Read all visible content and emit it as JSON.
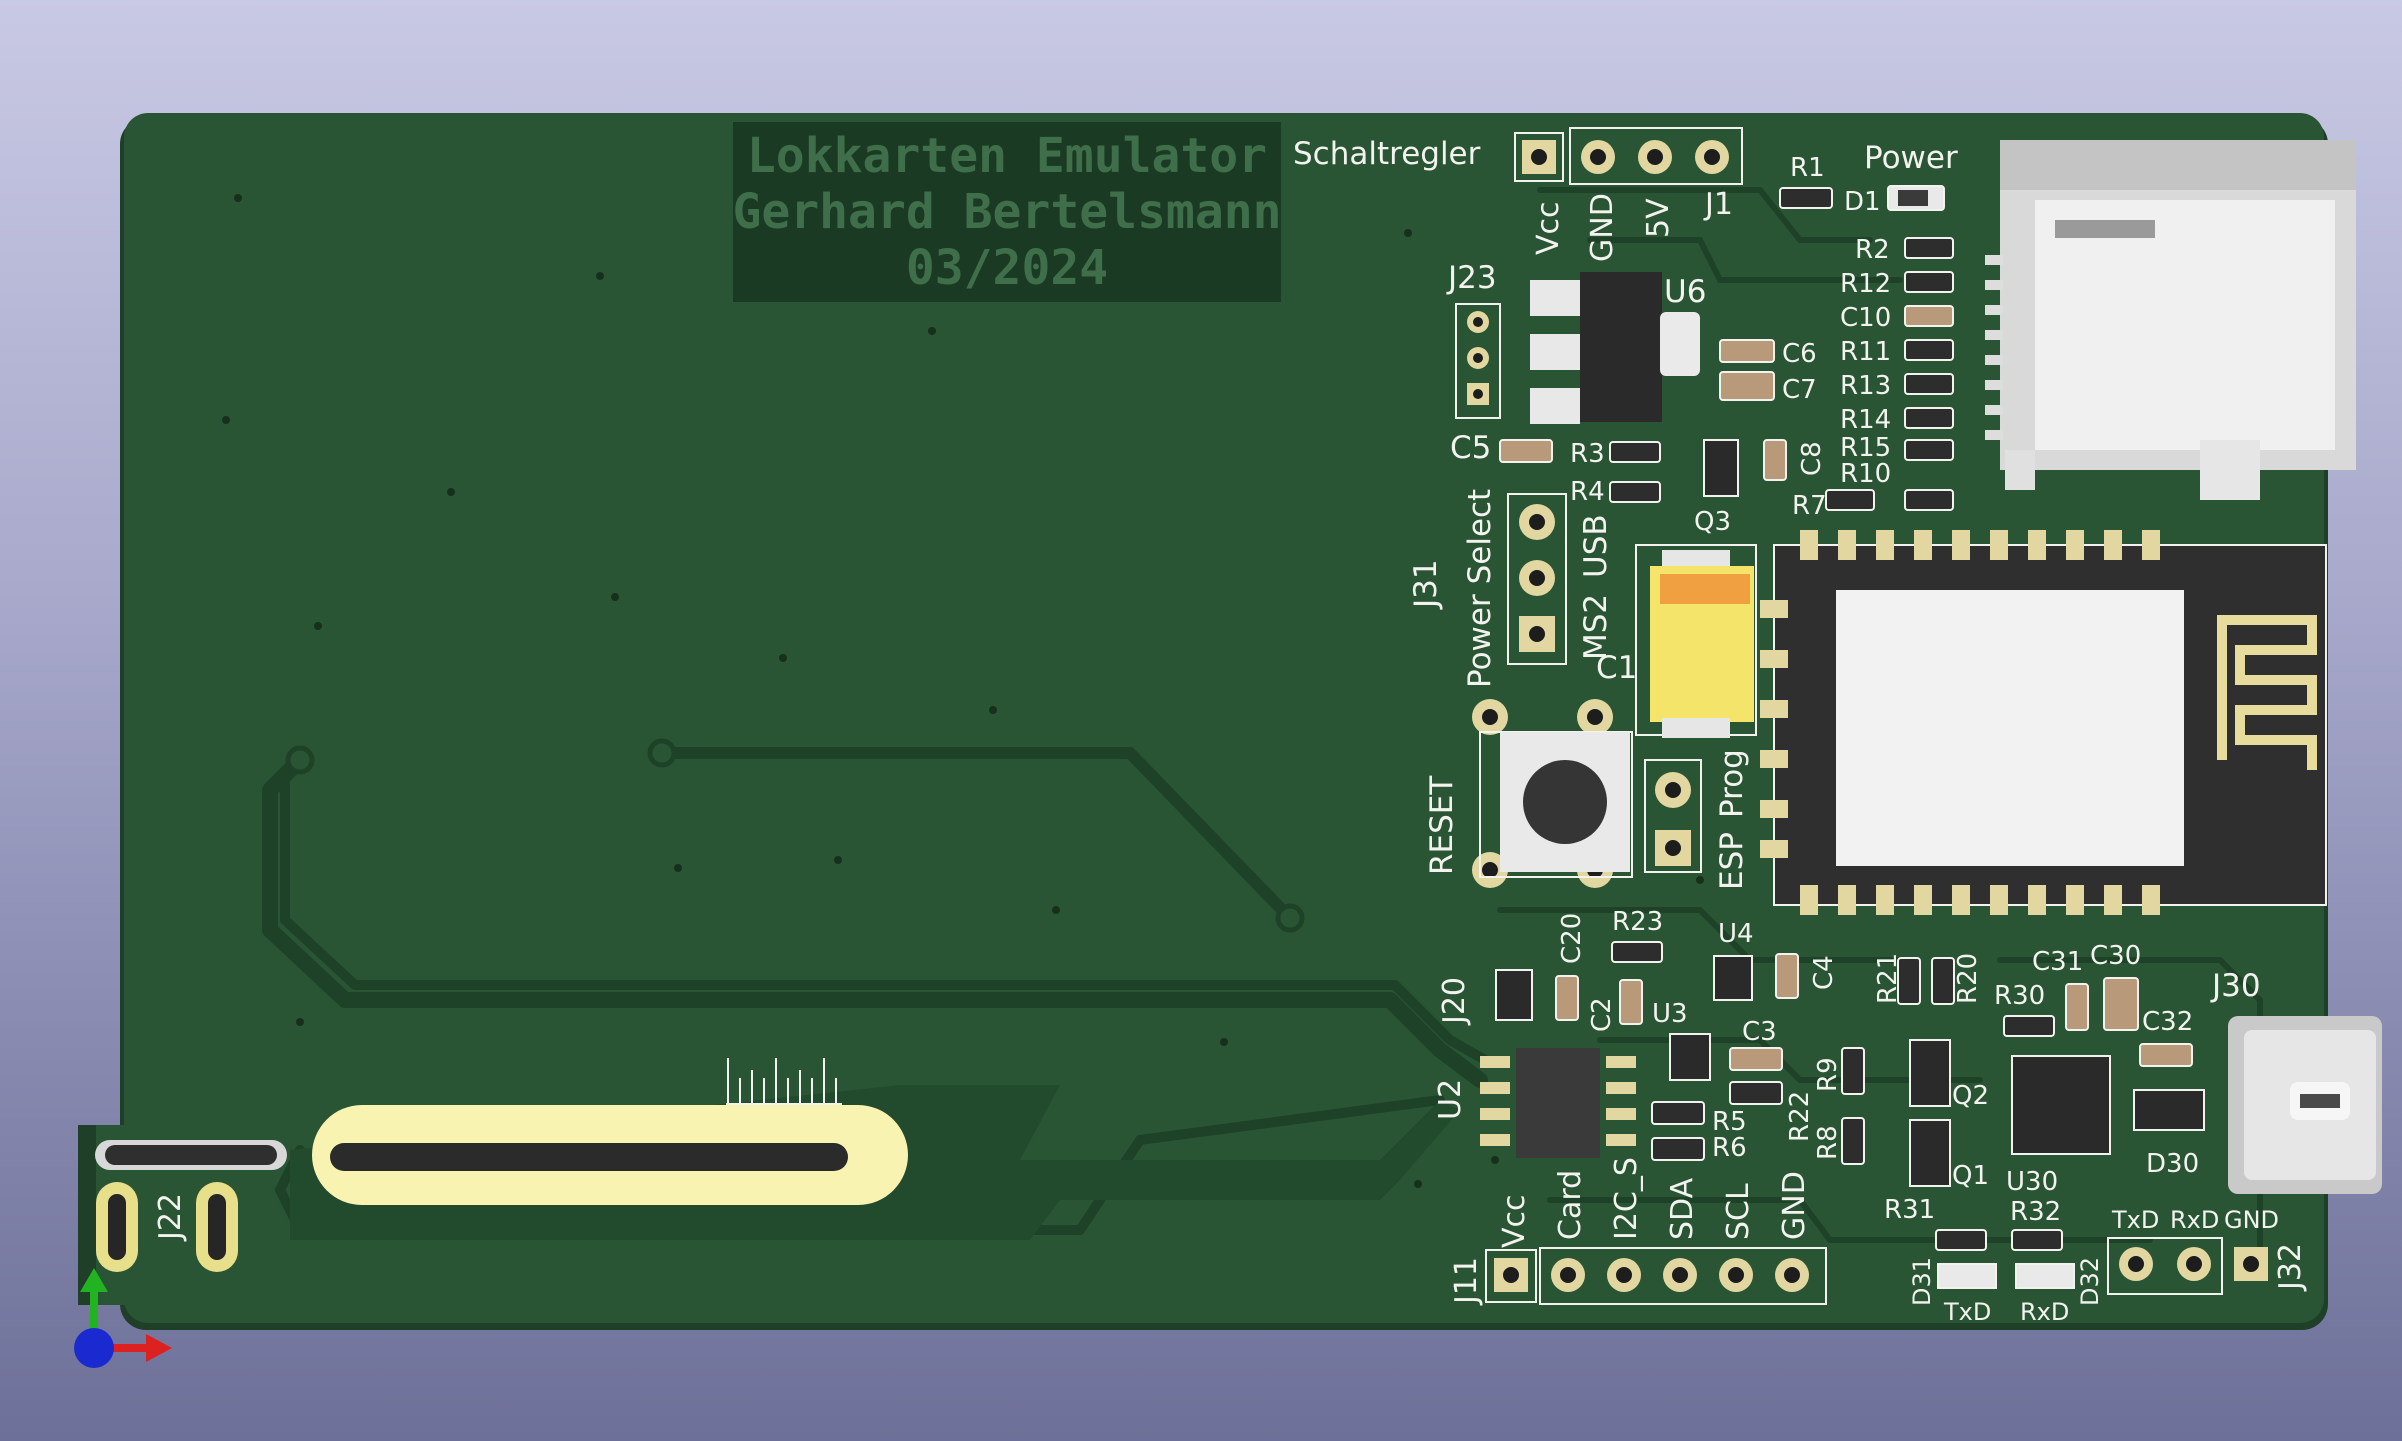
{
  "colors": {
    "board": "#2a5535",
    "copper_trace": "#1e4227",
    "pad_gold": "#e2d7a0",
    "silk": "#f2f2ee",
    "title_box": "#1b3a23",
    "title_text": "#3f6e4a",
    "cap_tantalum": "#f4e46a",
    "module": "#2f2f2f"
  },
  "title_block": {
    "line1": "Lokkarten Emulator",
    "line2": "Gerhard Bertelsmann",
    "line3": "03/2024"
  },
  "labels": {
    "schaltregler": "Schaltregler",
    "power": "Power",
    "vcc": "Vcc",
    "gnd": "GND",
    "v5": "5V",
    "j1": "J1",
    "r1": "R1",
    "d1": "D1",
    "j23": "J23",
    "u6": "U6",
    "c6": "C6",
    "c7": "C7",
    "c5": "C5",
    "r3": "R3",
    "r4": "R4",
    "c8": "C8",
    "q3": "Q3",
    "r7": "R7",
    "r2": "R2",
    "r12": "R12",
    "c10": "C10",
    "r11": "R11",
    "r13": "R13",
    "r14": "R14",
    "r15": "R15",
    "r10": "R10",
    "j31": "J31",
    "power_select": "Power Select",
    "usb": "USB",
    "ms2": "MS2",
    "c1": "C1",
    "reset": "RESET",
    "prog": "Prog",
    "esp": "ESP",
    "r23": "R23",
    "u4": "U4",
    "c4": "C4",
    "r21": "R21",
    "r20": "R20",
    "c20": "C20",
    "j20": "J20",
    "c2": "C2",
    "u3": "U3",
    "c3": "C3",
    "r30": "R30",
    "c31": "C31",
    "c30": "C30",
    "j30": "J30",
    "c32": "C32",
    "u2": "U2",
    "r5": "R5",
    "r6": "R6",
    "r22": "R22",
    "r9": "R9",
    "r8": "R8",
    "q2": "Q2",
    "q1": "Q1",
    "u30": "U30",
    "d30": "D30",
    "r31": "R31",
    "r32": "R32",
    "d31": "D31",
    "d32": "D32",
    "txd": "TxD",
    "rxd": "RxD",
    "j32": "J32",
    "j32_txd": "TxD",
    "j32_rxd": "RxD",
    "j32_gnd": "GND",
    "j22": "J22",
    "j11": "J11",
    "card": "Card",
    "i2c_s": "I2C_S",
    "sda": "SDA",
    "scl": "SCL"
  }
}
